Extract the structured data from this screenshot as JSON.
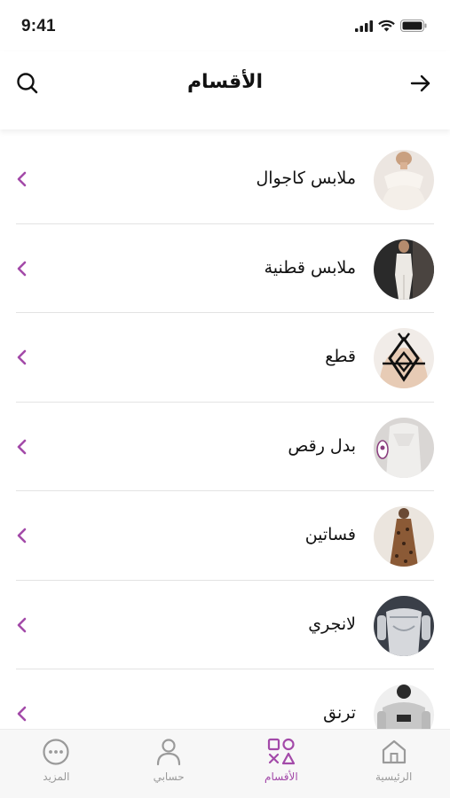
{
  "status_bar": {
    "time": "9:41"
  },
  "header": {
    "title": "الأقسام"
  },
  "colors": {
    "accent": "#a34aa9",
    "inactive": "#9a9a9a",
    "text": "#111111"
  },
  "categories": [
    {
      "label": "ملابس كاجوال",
      "thumb": "casual-top-image"
    },
    {
      "label": "ملابس قطنية",
      "thumb": "cotton-outfit-image"
    },
    {
      "label": "قطع",
      "thumb": "harness-piece-image"
    },
    {
      "label": "بدل رقص",
      "thumb": "dance-suit-image"
    },
    {
      "label": "فساتين",
      "thumb": "leopard-dress-image"
    },
    {
      "label": "لانجري",
      "thumb": "lingerie-image"
    },
    {
      "label": "ترنق",
      "thumb": "tracksuit-image"
    }
  ],
  "tabbar": {
    "home": "الرئيسية",
    "categories": "الأقسام",
    "account": "حسابي",
    "more": "المزيد",
    "active": "categories"
  }
}
